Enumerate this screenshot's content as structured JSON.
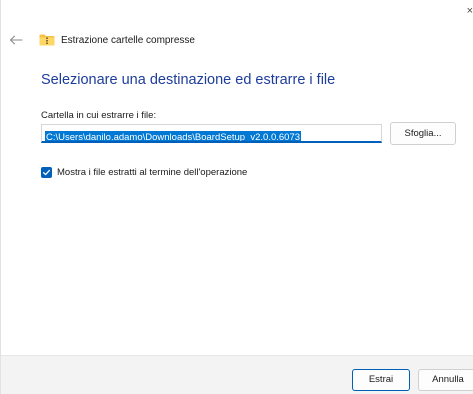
{
  "window": {
    "close_glyph": "×"
  },
  "header": {
    "back_icon": "back-arrow-icon",
    "folder_icon": "zip-folder-icon",
    "title": "Estrazione cartelle compresse"
  },
  "main": {
    "heading": "Selezionare una destinazione ed estrarre i file",
    "field_label": "Cartella in cui estrarre i file:",
    "path_value": "C:\\Users\\danilo.adamo\\Downloads\\BoardSetup_v2.0.0.6073",
    "browse_label": "Sfoglia...",
    "checkbox": {
      "checked": true,
      "label": "Mostra i file estratti al termine dell'operazione"
    }
  },
  "footer": {
    "extract_label": "Estrai",
    "cancel_label": "Annulla"
  },
  "colors": {
    "accent": "#005fb8",
    "heading": "#1d3d9a",
    "selection": "#0078d4",
    "footer_bg": "#f3f3f3"
  }
}
